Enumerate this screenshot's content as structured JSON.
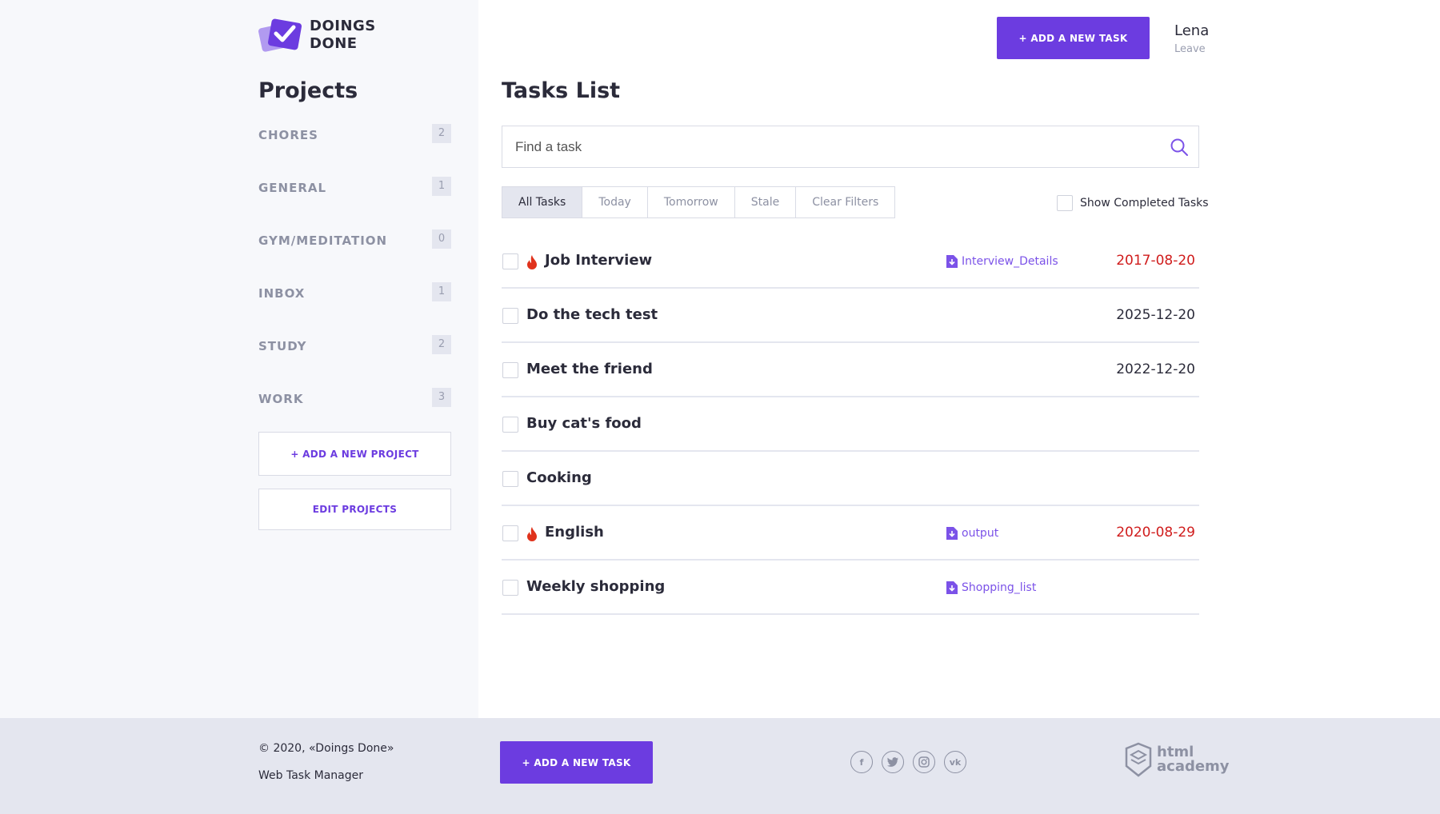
{
  "logo": {
    "line1": "DOINGS",
    "line2": "DONE"
  },
  "header": {
    "add_task_label": "+ ADD A NEW TASK",
    "user_name": "Lena",
    "leave_label": "Leave"
  },
  "sidebar": {
    "title": "Projects",
    "projects": [
      {
        "name": "CHORES",
        "count": "2"
      },
      {
        "name": "GENERAL",
        "count": "1"
      },
      {
        "name": "GYM/MEDITATION",
        "count": "0"
      },
      {
        "name": "INBOX",
        "count": "1"
      },
      {
        "name": "STUDY",
        "count": "2"
      },
      {
        "name": "WORK",
        "count": "3"
      }
    ],
    "add_project_label": "+ ADD A NEW PROJECT",
    "edit_projects_label": "EDIT PROJECTS"
  },
  "main": {
    "title": "Tasks List",
    "search_placeholder": "Find a task",
    "filters": [
      "All Tasks",
      "Today",
      "Tomorrow",
      "Stale",
      "Clear Filters"
    ],
    "active_filter": "All Tasks",
    "show_completed_label": "Show Completed Tasks",
    "tasks": [
      {
        "title": "Job Interview",
        "urgent": true,
        "file": "Interview_Details",
        "date": "2017-08-20",
        "overdue": true
      },
      {
        "title": "Do the tech test",
        "urgent": false,
        "file": "",
        "date": "2025-12-20",
        "overdue": false
      },
      {
        "title": "Meet the friend",
        "urgent": false,
        "file": "",
        "date": "2022-12-20",
        "overdue": false
      },
      {
        "title": "Buy cat's food",
        "urgent": false,
        "file": "",
        "date": "",
        "overdue": false
      },
      {
        "title": "Cooking",
        "urgent": false,
        "file": "",
        "date": "",
        "overdue": false
      },
      {
        "title": "English",
        "urgent": true,
        "file": "output",
        "date": "2020-08-29",
        "overdue": true
      },
      {
        "title": "Weekly shopping",
        "urgent": false,
        "file": "Shopping_list",
        "date": "",
        "overdue": false
      }
    ]
  },
  "footer": {
    "copyright": "© 2020, «Doings Done»",
    "subtitle": "Web Task Manager",
    "add_task_label": "+ ADD A NEW TASK",
    "socials": [
      "facebook-icon",
      "twitter-icon",
      "instagram-icon",
      "vk-icon"
    ],
    "academy_line1": "html",
    "academy_line2": "academy"
  },
  "colors": {
    "accent": "#6c3ce0",
    "overdue": "#d01c1c",
    "sidebar_bg": "#f7f8fb",
    "footer_bg": "#e4e6ef"
  }
}
